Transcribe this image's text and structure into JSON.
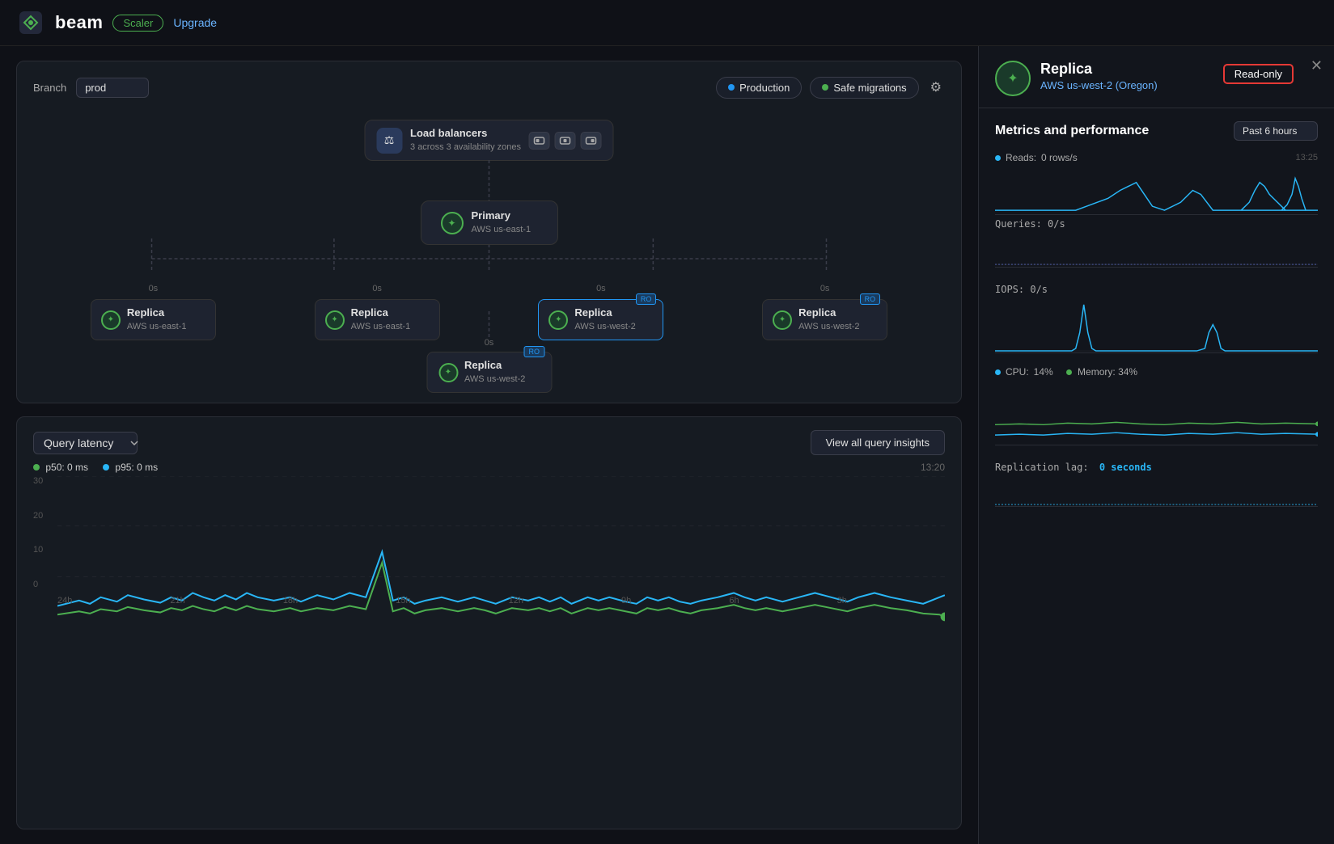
{
  "nav": {
    "logo": "beam",
    "badge_scaler": "Scaler",
    "link_upgrade": "Upgrade"
  },
  "topology": {
    "branch_label": "Branch",
    "branch_value": "prod",
    "env_production": "Production",
    "env_safe_migrations": "Safe migrations",
    "load_balancer_title": "Load balancers",
    "load_balancer_subtitle": "3 across 3 availability zones",
    "primary_title": "Primary",
    "primary_subtitle": "AWS us-east-1",
    "replicas": [
      {
        "title": "Replica",
        "subtitle": "AWS us-east-1",
        "latency": "0s",
        "ro": false,
        "active": false
      },
      {
        "title": "Replica",
        "subtitle": "AWS us-east-1",
        "latency": "0s",
        "ro": false,
        "active": false
      },
      {
        "title": "Replica",
        "subtitle": "AWS us-west-2",
        "latency": "0s",
        "ro": true,
        "active": true
      },
      {
        "title": "Replica",
        "subtitle": "AWS us-west-2",
        "latency": "0s",
        "ro": true,
        "active": false
      }
    ],
    "bottom_replica": {
      "title": "Replica",
      "subtitle": "AWS us-west-2",
      "latency": "0s",
      "ro": true
    }
  },
  "query_latency": {
    "label": "Query latency",
    "view_insights_btn": "View all query insights",
    "p50_label": "p50:",
    "p50_value": "0 ms",
    "p95_label": "p95:",
    "p95_value": "0 ms",
    "timestamp": "13:20",
    "y_labels": [
      "30",
      "20",
      "10",
      "0"
    ],
    "x_labels": [
      "24h",
      "21h",
      "18h",
      "15h",
      "12h",
      "9h",
      "6h",
      "3h",
      ""
    ]
  },
  "right_panel": {
    "title": "Replica",
    "subtitle": "AWS us-west-2 (Oregon)",
    "read_only_badge": "Read-only",
    "metrics_title": "Metrics and performance",
    "time_select": "Past 6 hours",
    "reads_label": "Reads:",
    "reads_value": "0 rows/s",
    "reads_ts": "13:25",
    "queries_label": "Queries: 0/s",
    "iops_label": "IOPS: 0/s",
    "cpu_label": "CPU:",
    "cpu_value": "14%",
    "memory_label": "Memory:",
    "memory_value": "34%",
    "replication_lag_label": "Replication lag:",
    "replication_lag_value": "0 seconds"
  }
}
